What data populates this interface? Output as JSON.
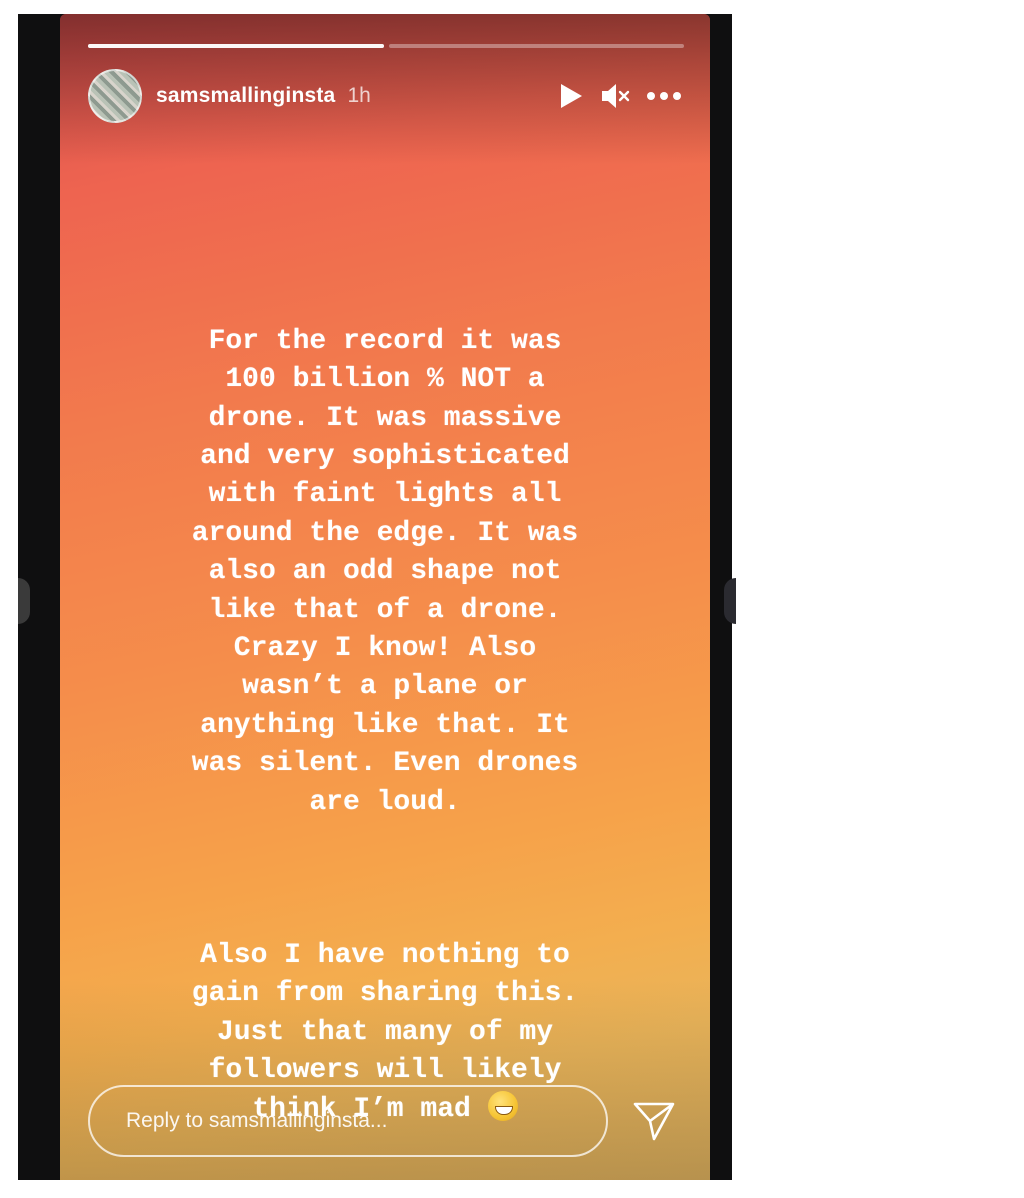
{
  "story": {
    "username": "samsmallinginsta",
    "time": "1h",
    "progress": [
      1.0,
      0.0
    ],
    "paragraphs": [
      "For the record it was\n100 billion % NOT a\ndrone. It was massive\nand very sophisticated\nwith faint lights all\naround the edge. It was\nalso an odd shape not\nlike that of a drone.\nCrazy I know! Also\nwasn’t a plane or\nanything like that. It\nwas silent. Even drones\nare loud.",
      "Also I have nothing to\ngain from sharing this.\nJust that many of my\nfollowers will likely\nthink I’m mad "
    ],
    "emoji_icon": "grinning-sweat-emoji",
    "icons": {
      "play": "play-icon",
      "mute": "mute-icon",
      "more": "more-options-icon",
      "send": "send-icon"
    }
  },
  "reply": {
    "placeholder": "Reply to samsmallinginsta..."
  }
}
